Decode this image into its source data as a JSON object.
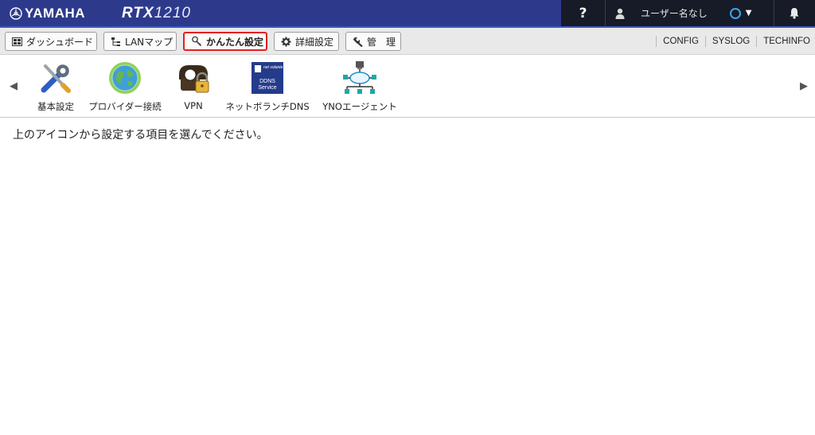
{
  "header": {
    "brand": "YAMAHA",
    "model_prefix": "RTX",
    "model_number": "1210",
    "help_label": "?",
    "user_name": "ユーザー名なし",
    "caret": "▼"
  },
  "toolbar": {
    "buttons": [
      {
        "label": "ダッシュボード",
        "icon": "dashboard-icon"
      },
      {
        "label": "LANマップ",
        "icon": "lan-map-icon"
      },
      {
        "label": "かんたん設定",
        "icon": "easy-setup-icon",
        "active": true
      },
      {
        "label": "詳細設定",
        "icon": "gear-icon"
      },
      {
        "label": "管　理",
        "icon": "wrench-icon"
      }
    ],
    "links": [
      "CONFIG",
      "SYSLOG",
      "TECHINFO"
    ]
  },
  "iconbar": {
    "left_arrow": "◀",
    "right_arrow": "▶",
    "items": [
      {
        "label": "基本設定",
        "icon": "tools-icon"
      },
      {
        "label": "プロバイダー接続",
        "icon": "globe-icon"
      },
      {
        "label": "VPN",
        "icon": "vpn-lock-icon"
      },
      {
        "label": "ネットボランチDNS",
        "icon": "ddns-service-icon",
        "badge_lines": [
          "net volante",
          "DDNS",
          "Service"
        ]
      },
      {
        "label": "YNOエージェント",
        "icon": "network-tree-icon"
      }
    ]
  },
  "main": {
    "instruction": "上のアイコンから設定する項目を選んでください。"
  },
  "colors": {
    "header_bg": "#2d3a8c",
    "header_dark": "#171a27",
    "active_border": "#e02020",
    "status_ring": "#3aa6e8"
  }
}
